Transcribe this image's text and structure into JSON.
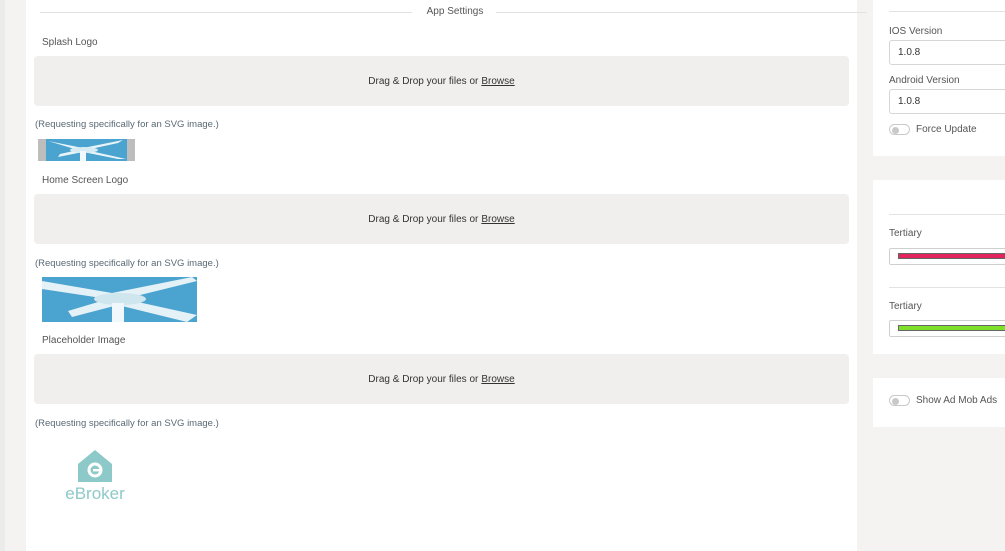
{
  "app_settings": {
    "section_title": "App Settings",
    "splash_logo": {
      "label": "Splash Logo",
      "drop_text": "Drag & Drop your files or",
      "browse": "Browse",
      "hint": "(Requesting specifically for an SVG image.)"
    },
    "home_screen_logo": {
      "label": "Home Screen Logo",
      "drop_text": "Drag & Drop your files or",
      "browse": "Browse",
      "hint": "(Requesting specifically for an SVG image.)"
    },
    "placeholder_image": {
      "label": "Placeholder Image",
      "drop_text": "Drag & Drop your files or",
      "browse": "Browse",
      "hint": "(Requesting specifically for an SVG image.)",
      "logo_text": "eBroker"
    }
  },
  "versions": {
    "ios_label": "IOS Version",
    "ios_value": "1.0.8",
    "android_label": "Android Version",
    "android_value": "1.0.8",
    "force_update_label": "Force Update"
  },
  "colors": {
    "items": [
      {
        "label": "Tertiary",
        "color": "#e0245e"
      },
      {
        "label": "Tertiary",
        "color": "#7fe02a"
      }
    ]
  },
  "ads": {
    "show_ad_mob_label": "Show Ad Mob Ads"
  },
  "theme": {
    "logo_teal": "#8ec9c9",
    "sky_blue": "#4ba3cf"
  }
}
